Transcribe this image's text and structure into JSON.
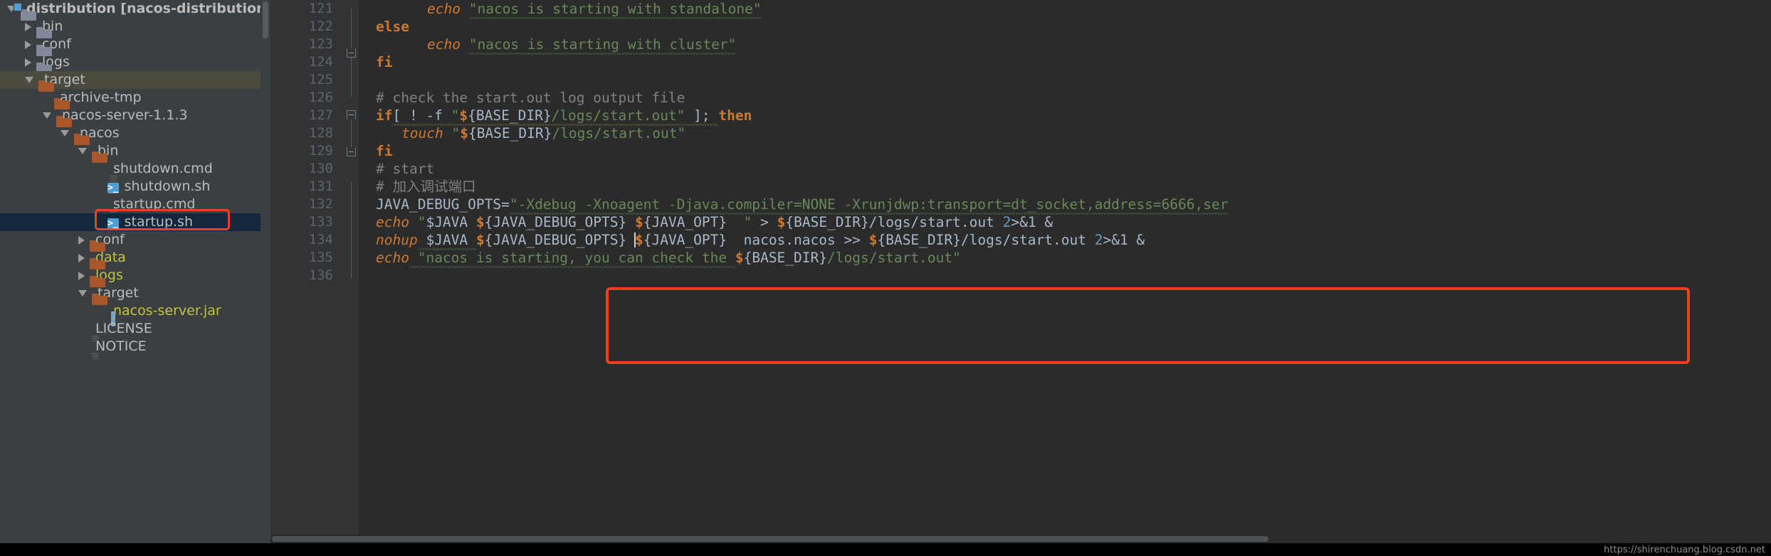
{
  "app": {
    "theme_bg": "#2b2b2b",
    "panel_bg": "#3c3f41",
    "accent_red": "#f1411c",
    "selection_blue": "#14273d"
  },
  "tree": {
    "items": [
      {
        "indent": 0,
        "twisty": "open",
        "icon": "module-folder-icon",
        "label": "distribution [nacos-distribution]",
        "style": "bold",
        "state": "none"
      },
      {
        "indent": 1,
        "twisty": "closed",
        "icon": "folder-grey-icon",
        "label": "bin",
        "style": "normal",
        "state": "none"
      },
      {
        "indent": 1,
        "twisty": "closed",
        "icon": "folder-grey-icon",
        "label": "conf",
        "style": "normal",
        "state": "none"
      },
      {
        "indent": 1,
        "twisty": "closed",
        "icon": "folder-grey-icon",
        "label": "logs",
        "style": "normal",
        "state": "none"
      },
      {
        "indent": 1,
        "twisty": "open",
        "icon": "folder-orange-icon",
        "label": "target",
        "style": "normal",
        "state": "inactive-selected"
      },
      {
        "indent": 2,
        "twisty": "none",
        "icon": "folder-orange-icon",
        "label": "archive-tmp",
        "style": "normal",
        "state": "none"
      },
      {
        "indent": 2,
        "twisty": "open",
        "icon": "folder-orange-icon",
        "label": "nacos-server-1.1.3",
        "style": "normal",
        "state": "none"
      },
      {
        "indent": 3,
        "twisty": "open",
        "icon": "folder-orange-icon",
        "label": "nacos",
        "style": "normal",
        "state": "none"
      },
      {
        "indent": 4,
        "twisty": "open",
        "icon": "folder-orange-icon",
        "label": "bin",
        "style": "normal",
        "state": "none"
      },
      {
        "indent": 5,
        "twisty": "none",
        "icon": "file-doc-icon",
        "label": "shutdown.cmd",
        "style": "normal",
        "state": "none"
      },
      {
        "indent": 5,
        "twisty": "none",
        "icon": "shell-script-icon",
        "label": "shutdown.sh",
        "style": "normal",
        "state": "none"
      },
      {
        "indent": 5,
        "twisty": "none",
        "icon": "file-doc-icon",
        "label": "startup.cmd",
        "style": "normal",
        "state": "none"
      },
      {
        "indent": 5,
        "twisty": "none",
        "icon": "shell-script-icon",
        "label": "startup.sh",
        "style": "normal",
        "state": "active-selected"
      },
      {
        "indent": 4,
        "twisty": "closed",
        "icon": "folder-orange-icon",
        "label": "conf",
        "style": "normal",
        "state": "none"
      },
      {
        "indent": 4,
        "twisty": "closed",
        "icon": "folder-orange-icon",
        "label": "data",
        "style": "excluded",
        "state": "none"
      },
      {
        "indent": 4,
        "twisty": "closed",
        "icon": "folder-orange-icon",
        "label": "logs",
        "style": "excluded",
        "state": "none"
      },
      {
        "indent": 4,
        "twisty": "open",
        "icon": "folder-orange-icon",
        "label": "target",
        "style": "normal",
        "state": "none"
      },
      {
        "indent": 5,
        "twisty": "none",
        "icon": "jar-archive-icon",
        "label": "nacos-server.jar",
        "style": "excluded",
        "state": "none"
      },
      {
        "indent": 4,
        "twisty": "none",
        "icon": "file-doc-icon",
        "label": "LICENSE",
        "style": "normal",
        "state": "none"
      },
      {
        "indent": 4,
        "twisty": "none",
        "icon": "file-doc-icon",
        "label": "NOTICE",
        "style": "normal",
        "state": "none"
      }
    ]
  },
  "editor": {
    "first_line_number": 121,
    "lines": [
      {
        "n": 121
      },
      {
        "n": 122
      },
      {
        "n": 123
      },
      {
        "n": 124
      },
      {
        "n": 125
      },
      {
        "n": 126
      },
      {
        "n": 127
      },
      {
        "n": 128
      },
      {
        "n": 129
      },
      {
        "n": 130
      },
      {
        "n": 131
      },
      {
        "n": 132
      },
      {
        "n": 133
      },
      {
        "n": 134
      },
      {
        "n": 135
      },
      {
        "n": 136
      }
    ],
    "code": {
      "l121_echo": "echo",
      "l121_str": "\"nacos is starting with standalone\"",
      "l122_else": "else",
      "l123_echo": "echo",
      "l123_str": "\"nacos is starting with cluster\"",
      "l124_fi": "fi",
      "l126_comment": "# check the start.out log output file",
      "l127_if": "if",
      "l127_test": "[ ! -f ",
      "l127_q1": "\"",
      "l127_dollar": "$",
      "l127_brace": "{BASE_DIR}",
      "l127_path": "/logs/start.out\"",
      "l127_tail": " ]; ",
      "l127_then": "then",
      "l128_touch": "touch",
      "l128_q1": "\"",
      "l128_dollar": "$",
      "l128_brace": "{BASE_DIR}",
      "l128_path": "/logs/start.out\"",
      "l129_fi": "fi",
      "l130_comment": "# start",
      "l131_comment": "# 加入调试端口",
      "l132_name": "JAVA_DEBUG_OPTS=",
      "l132_value": "\"-Xdebug -Xnoagent -Djava.compiler=NONE -Xrunjdwp:transport=dt_socket,address=6666,ser",
      "l133_echo": "echo",
      "l133_q1": " \"",
      "l133_java": "$JAVA ",
      "l133_d1": "$",
      "l133_b1": "{JAVA_DEBUG_OPTS} ",
      "l133_d2": "$",
      "l133_b2": "{JAVA_OPT}",
      "l133_q2": "  \"",
      "l133_gt": " > ",
      "l133_d3": "$",
      "l133_b3": "{BASE_DIR}",
      "l133_path": "/logs/start.out ",
      "l133_num": "2",
      "l133_tail": ">&1 &",
      "l134_nohup": "nohup",
      "l134_java": " $JAVA ",
      "l134_d1": "$",
      "l134_b1": "{JAVA_DEBUG_OPTS} ",
      "l134_d2": "$",
      "l134_b2": "{JAVA_OPT}",
      "l134_mid": "  nacos.nacos >> ",
      "l134_d3": "$",
      "l134_b3": "{BASE_DIR}",
      "l134_path": "/logs/start.out ",
      "l134_num": "2",
      "l134_tail": ">&1 &",
      "l135_echo": "echo",
      "l135_str": " \"nacos is starting, you can check the ",
      "l135_d1": "$",
      "l135_b1": "{BASE_DIR}",
      "l135_path": "/logs/start.out\""
    }
  },
  "watermark": {
    "text": "https://shirenchuang.blog.csdn.net"
  },
  "annotations": {
    "tree_highlight_target": "startup.sh",
    "code_highlight_lines": "131-134"
  }
}
